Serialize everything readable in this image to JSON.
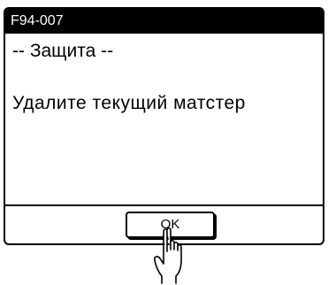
{
  "dialog": {
    "code": "F94-007",
    "heading": "-- Защита --",
    "message": "Удалите текущий матстер",
    "ok_label": "OK"
  },
  "icons": {
    "pointer": "hand-pointer-icon"
  }
}
